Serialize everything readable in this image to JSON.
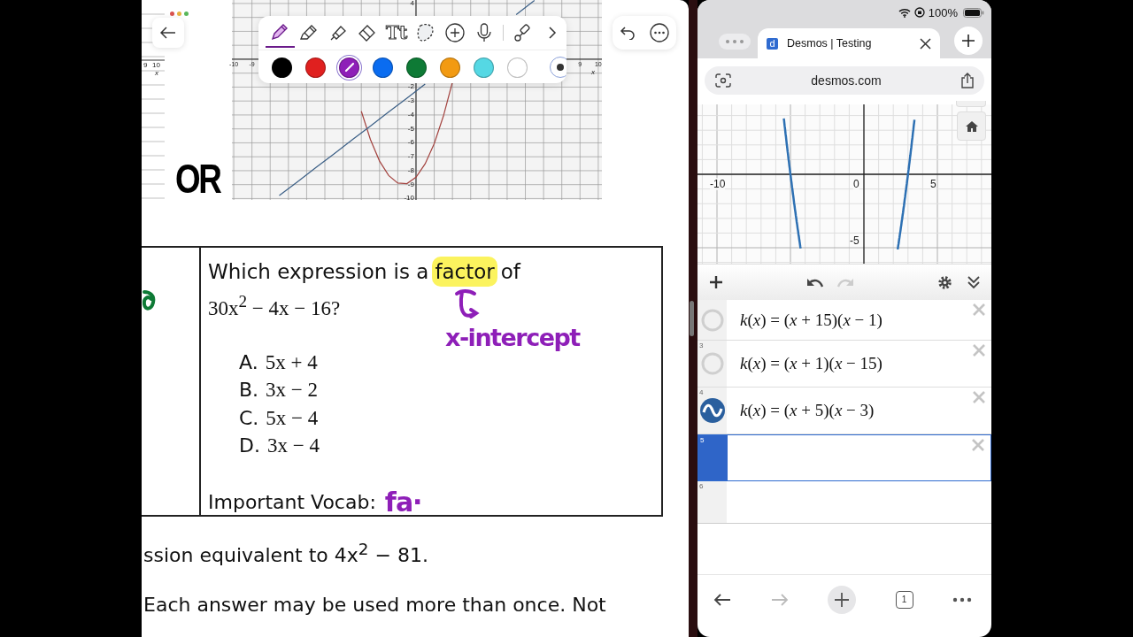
{
  "notes": {
    "toolbar": {
      "tools": [
        {
          "kind": "pen",
          "selected": true
        },
        {
          "kind": "pencil",
          "selected": false
        },
        {
          "kind": "marker",
          "selected": false
        },
        {
          "kind": "eraser",
          "selected": false
        },
        {
          "kind": "text",
          "label": "Tt",
          "selected": false
        },
        {
          "kind": "lasso",
          "selected": false
        },
        {
          "kind": "add",
          "selected": false
        },
        {
          "kind": "mic",
          "selected": false
        },
        {
          "kind": "ruler",
          "selected": false
        },
        {
          "kind": "more",
          "selected": false
        }
      ],
      "colors": [
        {
          "color": "#000000",
          "selected": false
        },
        {
          "color": "#e0201f",
          "selected": false
        },
        {
          "color": "#8e1fb8",
          "selected": true
        },
        {
          "color": "#0a6cf0",
          "selected": false
        },
        {
          "color": "#0e7a35",
          "selected": false
        },
        {
          "color": "#f29a12",
          "selected": false
        },
        {
          "color": "#55d8e4",
          "selected": false
        },
        {
          "color": "#ffffff",
          "selected": false
        }
      ]
    },
    "side_graph": {
      "x_labels": [
        "9",
        "10"
      ],
      "axis_name": "x"
    },
    "graph": {
      "chart_data": {
        "type": "line",
        "xlabel": "x",
        "x": [
          -7.5,
          -7,
          -6.5,
          -6,
          -5.5,
          -5,
          -4.5,
          -4,
          -3.5,
          -3,
          -2.5,
          -2,
          -1.5,
          -1,
          -0.5,
          0,
          0.5,
          1,
          1.5,
          2,
          5.5,
          6,
          6.5
        ],
        "series": [
          {
            "color": "#a3433f",
            "values": [
              null,
              null,
              null,
              null,
              null,
              null,
              null,
              null,
              null,
              -3.73,
              -5.77,
              -7.31,
              -8.35,
              -8.89,
              -8.93,
              -8.47,
              -7.51,
              -6.05,
              -4.09,
              -1.63,
              null,
              null,
              null
            ]
          },
          {
            "color": "#3b5f86",
            "values": [
              -9.79,
              -9.29,
              -8.79,
              -8.29,
              -7.79,
              -7.29,
              -6.79,
              -6.29,
              -5.79,
              -5.29,
              -4.79,
              -4.29,
              -3.79,
              -3.29,
              -2.79,
              -2.29,
              -1.79,
              null,
              null,
              null,
              3.21,
              3.71,
              4.21
            ]
          }
        ],
        "xlim": [
          -10.1,
          10.2
        ],
        "ylim": [
          -10.1,
          4.25
        ],
        "grid": true,
        "xticks": [
          -10,
          -9,
          9,
          10
        ],
        "yticks": [
          4,
          -2,
          -3,
          -4,
          -5,
          -6,
          -7,
          -8,
          -9,
          -10
        ]
      }
    },
    "or_label": "OR",
    "question": {
      "line1": [
        {
          "text": "Which expression is a",
          "highlighted": false
        },
        {
          "text": "factor",
          "highlighted": true
        },
        {
          "text": "of",
          "highlighted": false
        }
      ],
      "line2": "30x$^{2}$ − 4x − 16?",
      "options": [
        {
          "letter": "A.",
          "expr": "5x + 4"
        },
        {
          "letter": "B.",
          "expr": "3x − 2"
        },
        {
          "letter": "C.",
          "expr": "5x − 4"
        },
        {
          "letter": "D.",
          "expr": "3x − 4"
        }
      ],
      "vocab_label": "Important Vocab:",
      "ink_note": "x-intercept",
      "ink_vocab": "fa·"
    },
    "next_line": "ssion equivalent to 4x$^{2}$ − 81.",
    "last_line": "Each answer may be used more than once. Not"
  },
  "browser": {
    "battery": "100%",
    "tab": {
      "favicon": "d",
      "title": "Desmos | Testing"
    },
    "url": "desmos.com",
    "graph": {
      "x_labels": [
        "-10",
        "0",
        "5"
      ],
      "y_labels": [
        "-5"
      ]
    },
    "expressions": [
      {
        "expr": "*k*(*x*) = (*x* + 15)(*x* − 1)",
        "visible": false,
        "selected": false
      },
      {
        "number": "3",
        "expr": "*k*(*x*) = (*x* + 1)(*x* − 15)",
        "visible": false,
        "selected": false
      },
      {
        "number": "4",
        "expr": "*k*(*x*) = (*x* + 5)(*x* − 3)",
        "visible": true,
        "selected": false
      },
      {
        "number": "5",
        "selected": true
      }
    ],
    "empty_row": "6",
    "tab_count": "1"
  }
}
